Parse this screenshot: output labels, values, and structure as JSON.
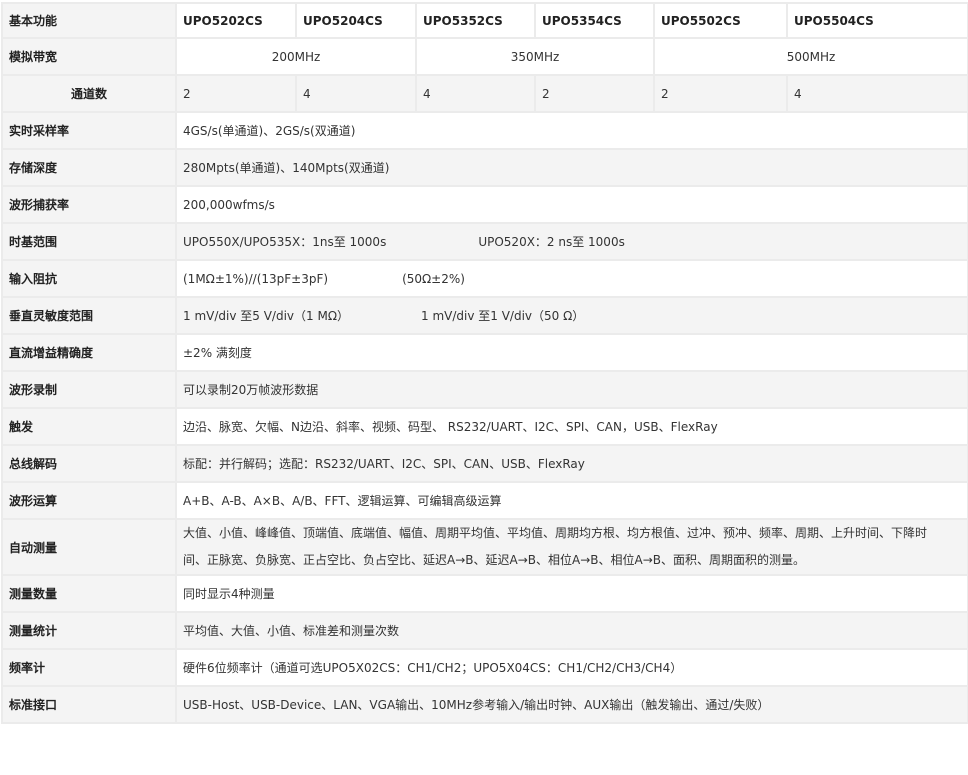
{
  "header": {
    "label": "基本功能",
    "models": [
      "UPO5202CS",
      "UPO5204CS",
      "UPO5352CS",
      "UPO5354CS",
      "UPO5502CS",
      "UPO5504CS"
    ]
  },
  "bandwidth": {
    "label": "模拟带宽",
    "values": [
      "200MHz",
      "350MHz",
      "500MHz"
    ]
  },
  "channels": {
    "label": "通道数",
    "values": [
      "2",
      "4",
      "4",
      "2",
      "2",
      "4"
    ]
  },
  "rows": {
    "sample_rate": {
      "label": "实时采样率",
      "value": "4GS/s(单通道)、2GS/s(双通道)"
    },
    "memory_depth": {
      "label": "存储深度",
      "value": "280Mpts(单通道)、140Mpts(双通道)"
    },
    "capture_rate": {
      "label": "波形捕获率",
      "value": "200,000wfms/s"
    },
    "timebase": {
      "label": "时基范围",
      "value_a": "UPO550X/UPO535X：1ns至 1000s",
      "value_b": "UPO520X：2 ns至 1000s"
    },
    "input_impedance": {
      "label": "输入阻抗",
      "value_a": "(1MΩ±1%)//(13pF±3pF)",
      "value_b": "(50Ω±2%)"
    },
    "vertical_sensitivity": {
      "label": "垂直灵敏度范围",
      "value_a": "1 mV/div 至5 V/div（1 MΩ）",
      "value_b": "1 mV/div 至1 V/div（50 Ω）"
    },
    "dc_gain": {
      "label": "直流增益精确度",
      "value": "±2% 满刻度"
    },
    "recording": {
      "label": "波形录制",
      "value": "可以录制20万帧波形数据"
    },
    "trigger": {
      "label": "触发",
      "value": "边沿、脉宽、欠幅、N边沿、斜率、视频、码型、 RS232/UART、I2C、SPI、CAN，USB、FlexRay"
    },
    "bus_decode": {
      "label": "总线解码",
      "value": "标配：并行解码；选配：RS232/UART、I2C、SPI、CAN、USB、FlexRay"
    },
    "math": {
      "label": "波形运算",
      "value": "A+B、A-B、A×B、A/B、FFT、逻辑运算、可编辑高级运算"
    },
    "auto_measure": {
      "label": "自动测量",
      "line1": "大值、小值、峰峰值、顶端值、底端值、幅值、周期平均值、平均值、周期均方根、均方根值、过冲、预冲、频率、周期、上升时间、下降时",
      "line2": "间、正脉宽、负脉宽、正占空比、负占空比、延迟A→B、延迟A→B、相位A→B、相位A→B、面积、周期面积的测量。"
    },
    "measure_count": {
      "label": "测量数量",
      "value": "同时显示4种测量"
    },
    "measure_stats": {
      "label": "测量统计",
      "value": "平均值、大值、小值、标准差和测量次数"
    },
    "freq_counter": {
      "label": "频率计",
      "value": "硬件6位频率计（通道可选UPO5X02CS：CH1/CH2；UPO5X04CS：CH1/CH2/CH3/CH4）"
    },
    "interfaces": {
      "label": "标准接口",
      "value": "USB-Host、USB-Device、LAN、VGA输出、10MHz参考输入/输出时钟、AUX输出（触发输出、通过/失败）"
    }
  }
}
